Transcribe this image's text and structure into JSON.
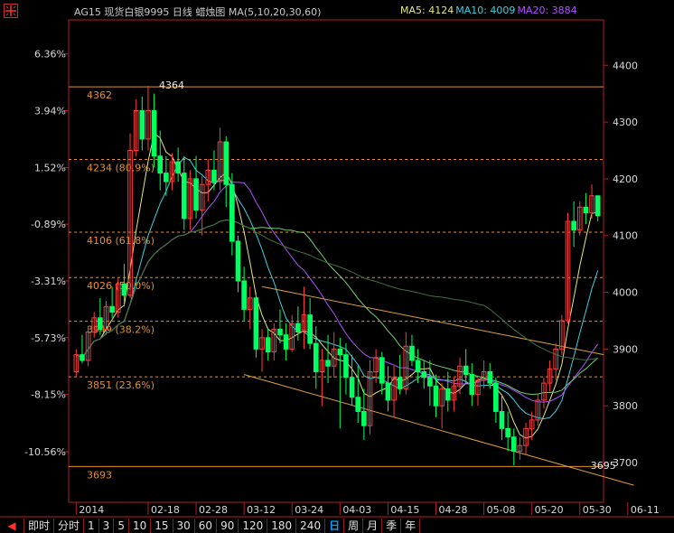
{
  "window": {
    "title": "AG15 现货白银9995 日线 蜡烛图 MA(5,10,20,30,60)"
  },
  "ma_readout": [
    {
      "label": "MA5:",
      "value": "4124",
      "color": "#e6e680"
    },
    {
      "label": "MA10:",
      "value": "4009",
      "color": "#40d0e0"
    },
    {
      "label": "MA20:",
      "value": "3884",
      "color": "#b050ff"
    }
  ],
  "period_tabs": [
    {
      "label": "即时",
      "active": false
    },
    {
      "label": "分时",
      "active": false
    },
    {
      "label": "1",
      "active": false
    },
    {
      "label": "3",
      "active": false
    },
    {
      "label": "5",
      "active": false
    },
    {
      "label": "10",
      "active": false
    },
    {
      "label": "15",
      "active": false
    },
    {
      "label": "30",
      "active": false
    },
    {
      "label": "60",
      "active": false
    },
    {
      "label": "90",
      "active": false
    },
    {
      "label": "120",
      "active": false
    },
    {
      "label": "180",
      "active": false
    },
    {
      "label": "240",
      "active": false
    },
    {
      "label": "日",
      "active": true
    },
    {
      "label": "周",
      "active": false
    },
    {
      "label": "月",
      "active": false
    },
    {
      "label": "季",
      "active": false
    },
    {
      "label": "年",
      "active": false
    }
  ],
  "chart_data": {
    "type": "candlestick",
    "title": "AG15 现货白银9995 日线 蜡烛图 MA(5,10,20,30,60)",
    "y_right_range": [
      3630,
      4480
    ],
    "y_right_ticks": [
      {
        "value": 4400,
        "label": "4400"
      },
      {
        "value": 4300,
        "label": "4300"
      },
      {
        "value": 4200,
        "label": "4200"
      },
      {
        "value": 4100,
        "label": "4100"
      },
      {
        "value": 4000,
        "label": "4000"
      },
      {
        "value": 3900,
        "label": "3900"
      },
      {
        "value": 3800,
        "label": "3800"
      },
      {
        "value": 3700,
        "label": "3700"
      }
    ],
    "y_left_ticks": [
      {
        "value": 4420,
        "label": "6.36%"
      },
      {
        "value": 4320,
        "label": "3.94%"
      },
      {
        "value": 4220,
        "label": "1.52%"
      },
      {
        "value": 4120,
        "label": "-0.89%"
      },
      {
        "value": 4020,
        "label": "-3.31%"
      },
      {
        "value": 3920,
        "label": "-5.73%"
      },
      {
        "value": 3820,
        "label": "-8.15%"
      },
      {
        "value": 3719,
        "label": "-10.56%"
      }
    ],
    "x_labels": [
      {
        "index": 0,
        "label": "2014"
      },
      {
        "index": 12,
        "label": "02-18"
      },
      {
        "index": 20,
        "label": "02-28"
      },
      {
        "index": 28,
        "label": "03-12"
      },
      {
        "index": 36,
        "label": "03-24"
      },
      {
        "index": 44,
        "label": "04-03"
      },
      {
        "index": 52,
        "label": "04-15"
      },
      {
        "index": 60,
        "label": "04-28"
      },
      {
        "index": 68,
        "label": "05-08"
      },
      {
        "index": 76,
        "label": "05-20"
      },
      {
        "index": 84,
        "label": "05-30"
      },
      {
        "index": 92,
        "label": "06-11"
      }
    ],
    "fib_levels": [
      {
        "value": 4362,
        "label": "4362"
      },
      {
        "value": 4234,
        "label": "4234 (80.9%)"
      },
      {
        "value": 4106,
        "label": "4106 (61.8%)"
      },
      {
        "value": 4026,
        "label": "4026 (50.0%)"
      },
      {
        "value": 3949,
        "label": "3949 (38.2%)"
      },
      {
        "value": 3851,
        "label": "3851 (23.6%)"
      },
      {
        "value": 3693,
        "label": "3693"
      }
    ],
    "annotations": [
      {
        "index": 12,
        "value": 4364,
        "label": "4364"
      },
      {
        "index": 84,
        "value": 3695,
        "label": "3695"
      }
    ],
    "channel_lines": [
      {
        "from": [
          31,
          4010
        ],
        "to": [
          88,
          3890
        ]
      },
      {
        "from": [
          28,
          3855
        ],
        "to": [
          93,
          3660
        ]
      }
    ],
    "ma_colors": [
      "#e6e680",
      "#40d0e0",
      "#b050ff",
      "#70d070",
      "#407040"
    ],
    "candles": [
      [
        3860,
        3900,
        3850,
        3890
      ],
      [
        3890,
        3925,
        3875,
        3880
      ],
      [
        3880,
        3940,
        3870,
        3930
      ],
      [
        3930,
        3965,
        3920,
        3955
      ],
      [
        3955,
        3990,
        3925,
        3935
      ],
      [
        3935,
        3985,
        3925,
        3975
      ],
      [
        3975,
        4010,
        3955,
        3965
      ],
      [
        3965,
        4025,
        3955,
        4015
      ],
      [
        4015,
        4050,
        3975,
        3995
      ],
      [
        3995,
        4280,
        3990,
        4250
      ],
      [
        4250,
        4340,
        4240,
        4320
      ],
      [
        4320,
        4345,
        4250,
        4270
      ],
      [
        4270,
        4364,
        4250,
        4320
      ],
      [
        4320,
        4350,
        4220,
        4240
      ],
      [
        4240,
        4285,
        4180,
        4210
      ],
      [
        4210,
        4240,
        4170,
        4195
      ],
      [
        4195,
        4245,
        4180,
        4230
      ],
      [
        4230,
        4255,
        4195,
        4210
      ],
      [
        4210,
        4240,
        4110,
        4130
      ],
      [
        4130,
        4215,
        4110,
        4200
      ],
      [
        4200,
        4240,
        4130,
        4145
      ],
      [
        4145,
        4205,
        4100,
        4190
      ],
      [
        4190,
        4235,
        4160,
        4215
      ],
      [
        4215,
        4250,
        4180,
        4195
      ],
      [
        4195,
        4290,
        4180,
        4265
      ],
      [
        4265,
        4275,
        4150,
        4190
      ],
      [
        4190,
        4210,
        4065,
        4090
      ],
      [
        4090,
        4100,
        4000,
        4020
      ],
      [
        4020,
        4045,
        3950,
        3970
      ],
      [
        3970,
        4010,
        3935,
        3990
      ],
      [
        3990,
        4000,
        3885,
        3900
      ],
      [
        3900,
        3935,
        3860,
        3920
      ],
      [
        3920,
        3935,
        3880,
        3895
      ],
      [
        3895,
        3945,
        3880,
        3935
      ],
      [
        3935,
        3970,
        3910,
        3925
      ],
      [
        3925,
        3945,
        3880,
        3900
      ],
      [
        3900,
        3960,
        3895,
        3945
      ],
      [
        3945,
        3975,
        3915,
        3930
      ],
      [
        3930,
        4010,
        3900,
        3960
      ],
      [
        3960,
        3990,
        3900,
        3910
      ],
      [
        3910,
        3940,
        3830,
        3860
      ],
      [
        3860,
        3900,
        3800,
        3880
      ],
      [
        3880,
        3925,
        3840,
        3870
      ],
      [
        3870,
        3930,
        3850,
        3900
      ],
      [
        3900,
        3920,
        3760,
        3890
      ],
      [
        3890,
        3910,
        3820,
        3850
      ],
      [
        3850,
        3890,
        3800,
        3815
      ],
      [
        3815,
        3870,
        3770,
        3790
      ],
      [
        3790,
        3830,
        3740,
        3765
      ],
      [
        3765,
        3880,
        3750,
        3860
      ],
      [
        3860,
        3900,
        3840,
        3885
      ],
      [
        3885,
        3895,
        3820,
        3840
      ],
      [
        3840,
        3870,
        3790,
        3810
      ],
      [
        3810,
        3870,
        3780,
        3850
      ],
      [
        3850,
        3890,
        3820,
        3830
      ],
      [
        3830,
        3930,
        3820,
        3905
      ],
      [
        3905,
        3925,
        3870,
        3880
      ],
      [
        3880,
        3900,
        3840,
        3860
      ],
      [
        3860,
        3880,
        3830,
        3850
      ],
      [
        3850,
        3880,
        3800,
        3835
      ],
      [
        3835,
        3855,
        3780,
        3800
      ],
      [
        3800,
        3840,
        3760,
        3830
      ],
      [
        3830,
        3860,
        3790,
        3810
      ],
      [
        3810,
        3850,
        3790,
        3835
      ],
      [
        3835,
        3885,
        3820,
        3870
      ],
      [
        3870,
        3900,
        3840,
        3855
      ],
      [
        3855,
        3875,
        3800,
        3820
      ],
      [
        3820,
        3850,
        3800,
        3845
      ],
      [
        3845,
        3880,
        3830,
        3860
      ],
      [
        3860,
        3875,
        3830,
        3840
      ],
      [
        3840,
        3850,
        3770,
        3790
      ],
      [
        3790,
        3820,
        3740,
        3760
      ],
      [
        3760,
        3790,
        3720,
        3745
      ],
      [
        3745,
        3760,
        3695,
        3720
      ],
      [
        3720,
        3745,
        3705,
        3730
      ],
      [
        3730,
        3770,
        3715,
        3760
      ],
      [
        3760,
        3790,
        3740,
        3775
      ],
      [
        3775,
        3820,
        3765,
        3810
      ],
      [
        3810,
        3850,
        3795,
        3840
      ],
      [
        3840,
        3880,
        3825,
        3865
      ],
      [
        3865,
        3910,
        3845,
        3900
      ],
      [
        3900,
        3960,
        3890,
        3950
      ],
      [
        3950,
        4140,
        3945,
        4125
      ],
      [
        4125,
        4160,
        4080,
        4110
      ],
      [
        4110,
        4160,
        4100,
        4150
      ],
      [
        4150,
        4175,
        4120,
        4140
      ],
      [
        4140,
        4190,
        4130,
        4170
      ],
      [
        4170,
        4165,
        4125,
        4135
      ]
    ]
  }
}
